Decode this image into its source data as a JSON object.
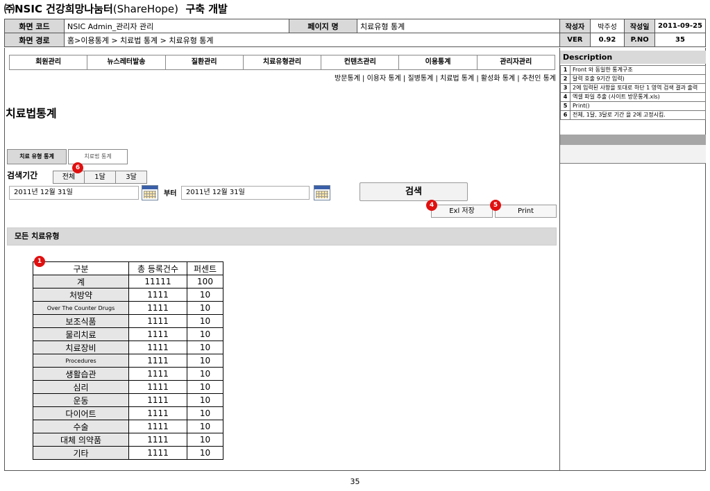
{
  "doc_title": {
    "main": "㈜NSIC 건강희망나눔터",
    "paren": "(ShareHope)",
    "suffix": "구축 개발"
  },
  "header": {
    "screen_code_label": "화면 코드",
    "screen_code": "NSIC Admin_관리자 관리",
    "page_name_label": "페이지 명",
    "page_name": "치료유형 통계",
    "screen_path_label": "화면 경로",
    "screen_path": "홈>이용통계 > 치료법 통계 >  치료유형 통계",
    "author_label": "작성자",
    "author": "박주성",
    "date_label": "작성일",
    "date": "2011-09-25",
    "ver_label": "VER",
    "ver": "0.92",
    "pno_label": "P.NO",
    "pno": "35"
  },
  "menu": [
    "회원관리",
    "뉴스레터발송",
    "질환관리",
    "치료유형관리",
    "컨텐츠관리",
    "이용통계",
    "관리자관리"
  ],
  "submenu": "방문통계 |  이용자 통계 | 질병통계 | 치료법 통계 | 활성화 통계 | 추천인 통계",
  "page_title": "치료법통계",
  "tabs": {
    "type_stats": "치료 유형 통계",
    "method_stats": "치료법 통계"
  },
  "search": {
    "period_label": "검색기간",
    "period_buttons": {
      "all": "전체",
      "one_month": "1달",
      "three_months": "3달"
    },
    "date_from": "2011년 12월 31일",
    "from_label": "부터",
    "date_to": "2011년 12월 31일",
    "search_label": "검색",
    "excel_label": "Exl 저장",
    "print_label": "Print"
  },
  "badges": {
    "b1": "1",
    "b4": "4",
    "b5": "5",
    "b6": "6"
  },
  "section_title": "모든 치료유형",
  "table": {
    "headers": [
      "구분",
      "총 등록건수",
      "퍼센트"
    ],
    "rows": [
      {
        "category": "계",
        "count": "11111",
        "percent": "100"
      },
      {
        "category": "처방약",
        "count": "1111",
        "percent": "10"
      },
      {
        "category": "Over The Counter Drugs",
        "count": "1111",
        "percent": "10"
      },
      {
        "category": "보조식품",
        "count": "1111",
        "percent": "10"
      },
      {
        "category": "물리치료",
        "count": "1111",
        "percent": "10"
      },
      {
        "category": "치료장비",
        "count": "1111",
        "percent": "10"
      },
      {
        "category": "Procedures",
        "count": "1111",
        "percent": "10"
      },
      {
        "category": "생활습관",
        "count": "1111",
        "percent": "10"
      },
      {
        "category": "심리",
        "count": "1111",
        "percent": "10"
      },
      {
        "category": "운동",
        "count": "1111",
        "percent": "10"
      },
      {
        "category": "다이어트",
        "count": "1111",
        "percent": "10"
      },
      {
        "category": "수술",
        "count": "1111",
        "percent": "10"
      },
      {
        "category": "대체 의약품",
        "count": "1111",
        "percent": "10"
      },
      {
        "category": "기타",
        "count": "1111",
        "percent": "10"
      }
    ]
  },
  "description": {
    "title": "Description",
    "items": [
      {
        "no": "1",
        "text": "Front 와 동일한 통계구조"
      },
      {
        "no": "2",
        "text": "달력 호출 9기간 입력)"
      },
      {
        "no": "3",
        "text": "2에 입력된 사항을 토대로 하단 1 영역 검색 결과 출력"
      },
      {
        "no": "4",
        "text": "엑셀 파일 추출 (사이트 방문통계.xls)"
      },
      {
        "no": "5",
        "text": "Print()"
      },
      {
        "no": "6",
        "text": "전체, 1달, 3달로 기간 을 2에 고정시킴."
      }
    ]
  },
  "page_number": "35"
}
